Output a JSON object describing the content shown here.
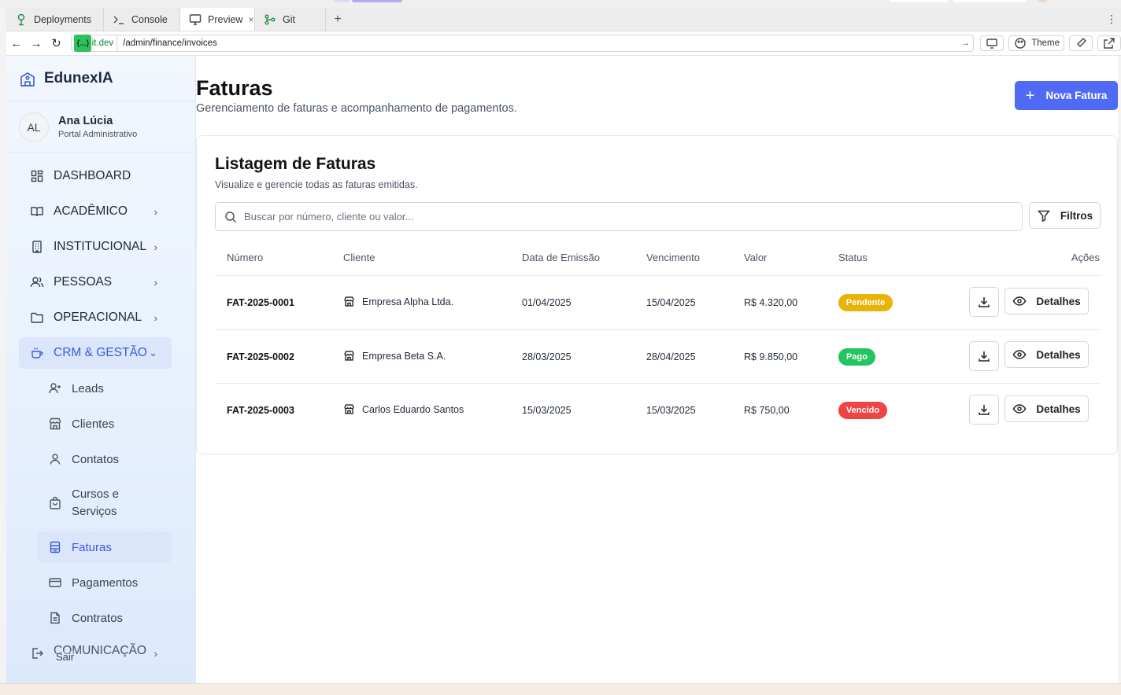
{
  "browser": {
    "tabs": [
      {
        "label": "Deployments",
        "icon": "deployments-icon"
      },
      {
        "label": "Console",
        "icon": "console-icon"
      },
      {
        "label": "Preview",
        "icon": "preview-icon",
        "active": true
      },
      {
        "label": "Git",
        "icon": "git-icon"
      }
    ],
    "new_tab": "+",
    "more": "⋮",
    "url_domain_badge": "{...}",
    "url_domain": ".replit.dev",
    "url_path": "/admin/finance/invoices",
    "theme_label": "Theme"
  },
  "sidebar": {
    "brand": "EdunexIA",
    "user": {
      "initials": "AL",
      "name": "Ana Lúcia",
      "role": "Portal Administrativo"
    },
    "items": [
      {
        "label": "DASHBOARD"
      },
      {
        "label": "ACADÊMICO"
      },
      {
        "label": "INSTITUCIONAL"
      },
      {
        "label": "PESSOAS"
      },
      {
        "label": "OPERACIONAL"
      },
      {
        "label": "CRM & GESTÃO"
      }
    ],
    "subitems": [
      {
        "label": "Leads"
      },
      {
        "label": "Clientes"
      },
      {
        "label": "Contatos"
      },
      {
        "label": "Cursos e Serviços"
      },
      {
        "label": "Faturas"
      },
      {
        "label": "Pagamentos"
      },
      {
        "label": "Contratos"
      }
    ],
    "comunicacao": "COMUNICAÇÃO",
    "logout": "Sair"
  },
  "header": {
    "title": "Faturas",
    "subtitle": "Gerenciamento de faturas e acompanhamento de pagamentos.",
    "new_button": "Nova Fatura"
  },
  "card": {
    "title": "Listagem de Faturas",
    "subtitle": "Visualize e gerencie todas as faturas emitidas.",
    "search_placeholder": "Buscar por número, cliente ou valor...",
    "filters_label": "Filtros",
    "columns": [
      "Número",
      "Cliente",
      "Data de Emissão",
      "Vencimento",
      "Valor",
      "Status",
      "Ações"
    ],
    "rows": [
      {
        "numero": "FAT-2025-0001",
        "cliente": "Empresa Alpha Ltda.",
        "emissao": "01/04/2025",
        "vencimento": "15/04/2025",
        "valor": "R$ 4.320,00",
        "status": "Pendente",
        "status_color": "#eab308",
        "action": "Detalhes"
      },
      {
        "numero": "FAT-2025-0002",
        "cliente": "Empresa Beta S.A.",
        "emissao": "28/03/2025",
        "vencimento": "28/04/2025",
        "valor": "R$ 9.850,00",
        "status": "Pago",
        "status_color": "#22c55e",
        "action": "Detalhes"
      },
      {
        "numero": "FAT-2025-0003",
        "cliente": "Carlos Eduardo Santos",
        "emissao": "15/03/2025",
        "vencimento": "15/03/2025",
        "valor": "R$ 750,00",
        "status": "Vencido",
        "status_color": "#ef4444",
        "action": "Detalhes"
      }
    ]
  },
  "colors": {
    "accent": "#4f6bf5",
    "active_nav": "#3b5bdb"
  }
}
